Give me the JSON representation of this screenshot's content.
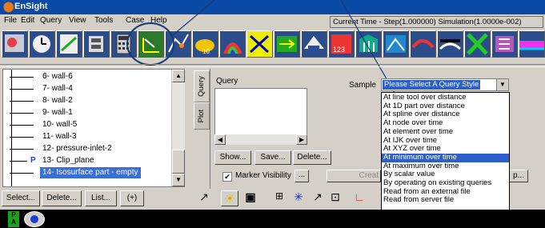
{
  "window": {
    "title": "EnSight",
    "icon": "ensight-logo-icon"
  },
  "menu": [
    "File",
    "Edit",
    "Query",
    "View",
    "Tools",
    "Case",
    "Help"
  ],
  "time_status": "Current Time - Step(1.000000) Simulation(1.0000e-002)",
  "toolbar_icons": [
    "part-info-icon",
    "time-icon",
    "annotation-icon",
    "frame-icon",
    "calculator-icon",
    "query-probe-icon",
    "plot-icon",
    "isosurface-icon",
    "color-icon",
    "clip-icon",
    "vector-arrow-icon",
    "elevated-surface-icon",
    "contour-icon",
    "particle-trace-icon",
    "flipbook-icon",
    "render-icon",
    "streamline-icon",
    "subset-icon",
    "material-icon",
    "more-icon"
  ],
  "tree": {
    "items": [
      {
        "label": "6- wall-6"
      },
      {
        "label": "7- wall-4"
      },
      {
        "label": "8- wall-2"
      },
      {
        "label": "9- wall-1"
      },
      {
        "label": "10- wall-5"
      },
      {
        "label": "11- wall-3"
      },
      {
        "label": "12- pressure-inlet-2"
      },
      {
        "label": "13- Clip_plane",
        "marker": "P"
      },
      {
        "label": "14- Isosurface part - empty",
        "selected": true
      }
    ]
  },
  "tabs": {
    "query": "Query",
    "plot": "Plot"
  },
  "query_panel": {
    "title": "Query",
    "show_button": "Show...",
    "save_button": "Save...",
    "delete_button": "Delete...",
    "marker_visibility_label": "Marker Visibility",
    "marker_visibility_checked": true,
    "marker_more": "...",
    "create_label": "Creat",
    "right_button": "p..."
  },
  "sample": {
    "label": "Sample",
    "selected": "Please Select A Query Style",
    "options": [
      "At line tool over distance",
      "At 1D part over distance",
      "At spline over distance",
      "At node over time",
      "At element over time",
      "At IJK over time",
      "At XYZ over time",
      "At minimum over time",
      "At maximum over time",
      "By scalar value",
      "By operating on existing queries",
      "Read from an external file",
      "Read from server file"
    ],
    "highlighted_index": 7
  },
  "bottom": {
    "select": "Select...",
    "delete": "Delete...",
    "list": "List...",
    "plus": "(+)"
  },
  "bottom_tools": [
    "select-arrow-icon",
    "light-icon",
    "box-icon",
    "grid-icon",
    "axis-icon",
    "arrow-icon",
    "zoom-icon",
    "axis-triad-icon"
  ],
  "status_icons": [
    "pa-badge-icon",
    "eye-icon"
  ]
}
